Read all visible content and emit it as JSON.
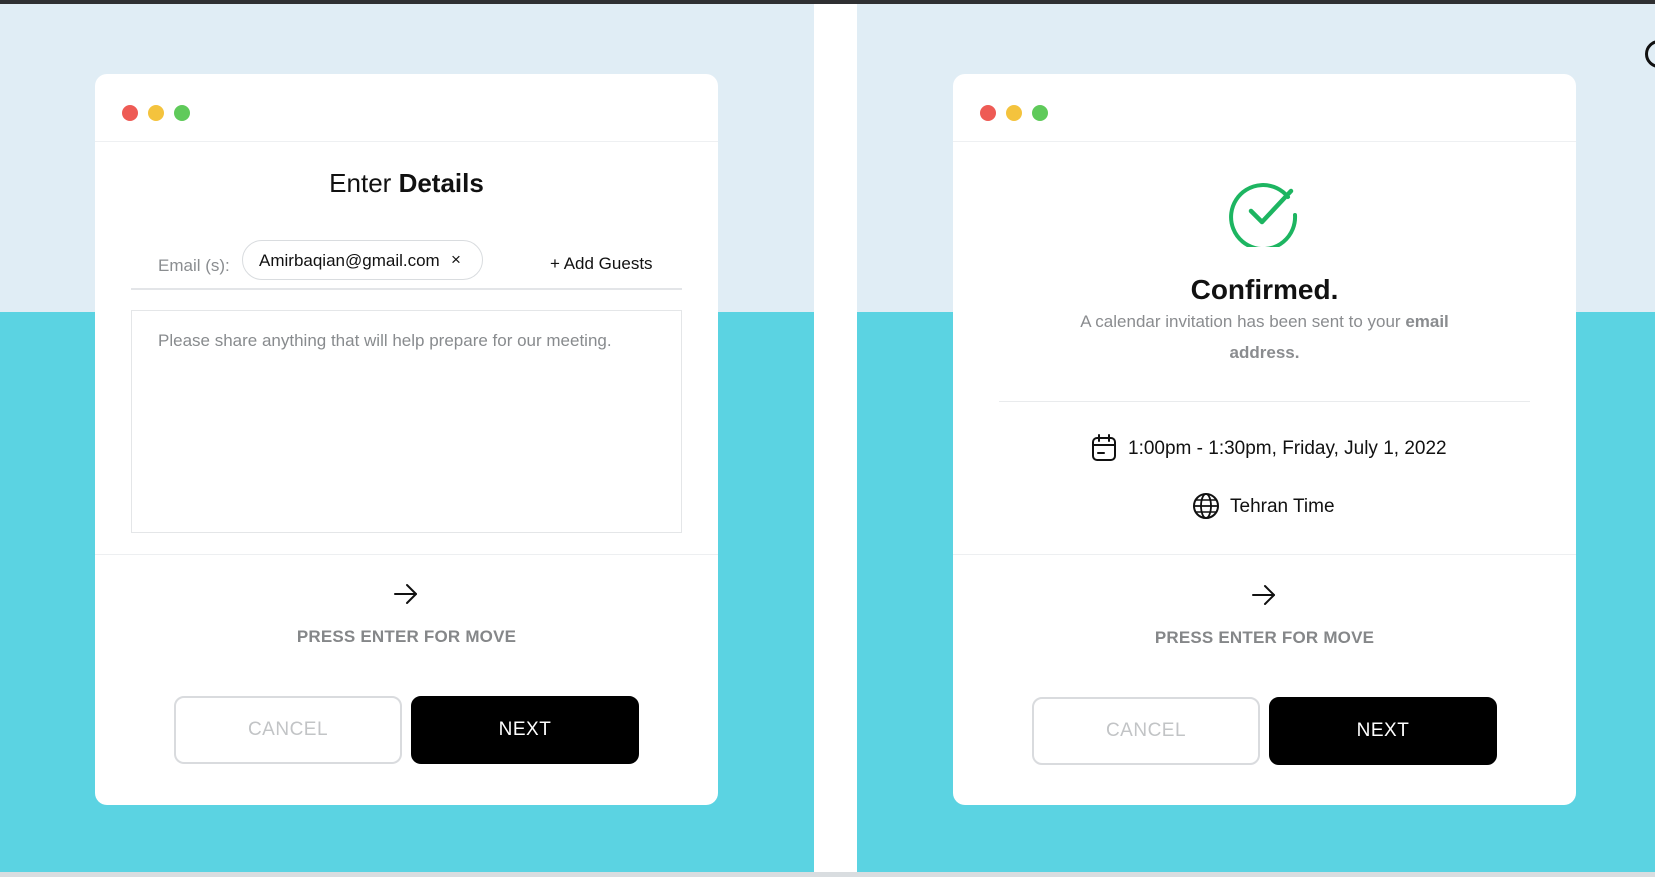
{
  "colors": {
    "background_light": "#e0edf5",
    "background_accent": "#5bd3e2",
    "card": "#ffffff",
    "dot_red": "#ee5b55",
    "dot_yellow": "#f4c33d",
    "dot_green": "#5fca5a",
    "success": "#1db561",
    "primary_button": "#000000"
  },
  "details_screen": {
    "window_controls": [
      "close-dot",
      "minimize-dot",
      "maximize-dot"
    ],
    "title_regular": "Enter",
    "title_bold": "Details",
    "email_label": "Email (s):",
    "email_chip": "Amirbaqian@gmail.com",
    "email_remove": "×",
    "add_guests": "+ Add Guests",
    "notes_value": "",
    "notes_placeholder": "Please share anything that will help prepare for our meeting.",
    "arrow_icon": "arrow-right-icon",
    "hint": "PRESS ENTER FOR MOVE",
    "cancel_label": "CANCEL",
    "next_label": "NEXT"
  },
  "confirmation_screen": {
    "window_controls": [
      "close-dot",
      "minimize-dot",
      "maximize-dot"
    ],
    "status_icon": "check-circle-icon",
    "title": "Confirmed.",
    "message_regular": "A calendar invitation has been sent to your",
    "message_bold": "email address.",
    "time_icon": "calendar-icon",
    "time": "1:00pm - 1:30pm, Friday, July 1, 2022",
    "zone_icon": "globe-icon",
    "timezone": "Tehran Time",
    "arrow_icon": "arrow-right-icon",
    "hint": "PRESS ENTER FOR MOVE",
    "cancel_label": "CANCEL",
    "next_label": "NEXT"
  }
}
